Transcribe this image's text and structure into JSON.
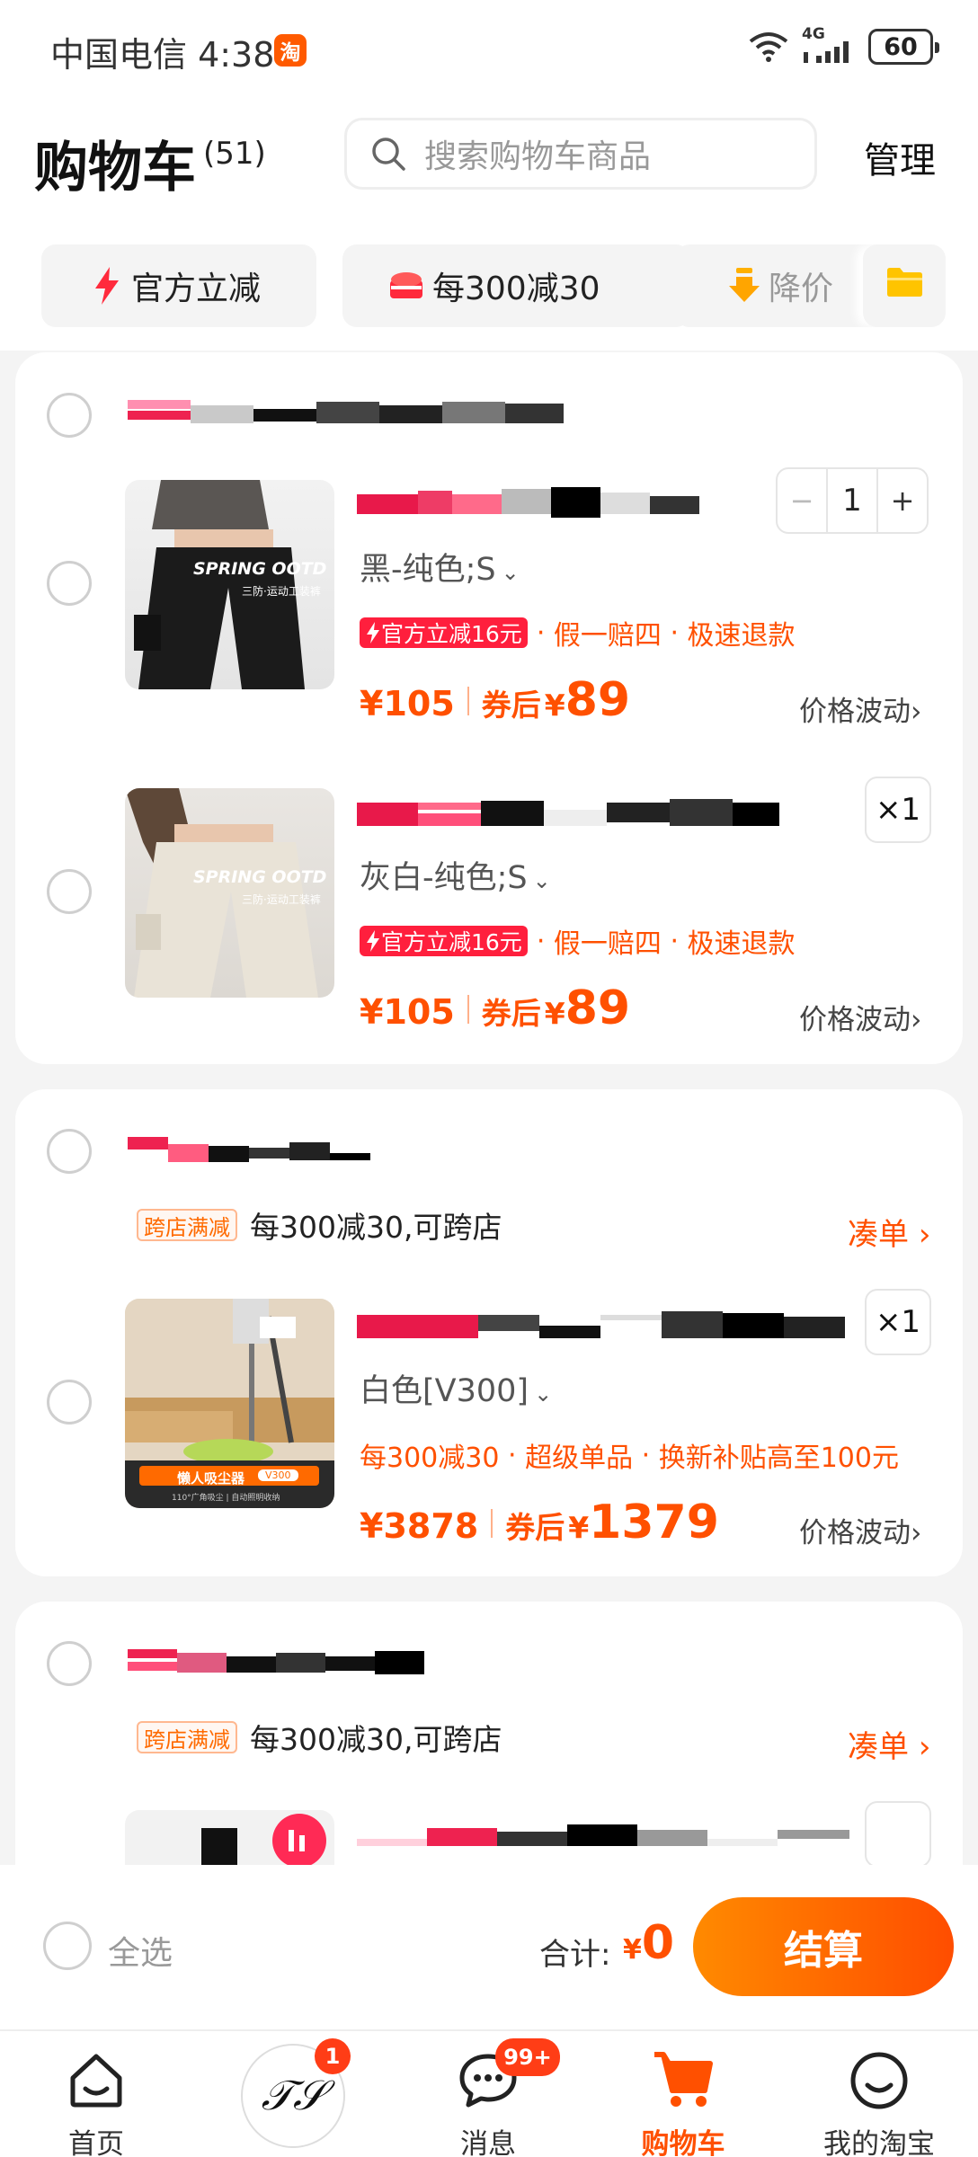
{
  "status_bar": {
    "carrier_time": "中国电信 4:38",
    "app_badge": "淘",
    "network": "4G",
    "battery": "60"
  },
  "header": {
    "title": "购物车",
    "count": "(51)",
    "search_placeholder": "搜索购物车商品",
    "manage": "管理"
  },
  "filter_chips": [
    {
      "label": "官方立减",
      "icon": "lightning-icon"
    },
    {
      "label": "每300减30",
      "icon": "gift-icon"
    },
    {
      "label": "降价",
      "icon": "down-arrow-icon"
    },
    {
      "label": "",
      "icon": "folder-icon"
    }
  ],
  "stores": [
    {
      "items": [
        {
          "variant": "黑-纯色;S",
          "promo_badge": "官方立减16元",
          "tags": [
            "假一赔四",
            "极速退款"
          ],
          "price": "¥105",
          "after_label": "券后",
          "after_currency": "¥",
          "after_price": "89",
          "fluctuation": "价格波动",
          "quantity": "1",
          "thumb_caption": "SPRING OOTD",
          "thumb_subcaption": "三防·运动工装裤"
        },
        {
          "variant": "灰白-纯色;S",
          "promo_badge": "官方立减16元",
          "tags": [
            "假一赔四",
            "极速退款"
          ],
          "price": "¥105",
          "after_label": "券后",
          "after_currency": "¥",
          "after_price": "89",
          "fluctuation": "价格波动",
          "quantity": "×1",
          "thumb_caption": "SPRING OOTD",
          "thumb_subcaption": "三防·运动工装裤"
        }
      ]
    },
    {
      "cross_badge": "跨店满减",
      "cross_text": "每300减30,可跨店",
      "coudan": "凑单",
      "items": [
        {
          "variant": "白色[V300]",
          "tags": [
            "每300减30",
            "超级单品",
            "换新补贴高至100元"
          ],
          "price": "¥3878",
          "after_label": "券后",
          "after_currency": "¥",
          "after_price": "1379",
          "fluctuation": "价格波动",
          "quantity": "×1",
          "thumb_caption": "懒人吸尘器",
          "thumb_tag": "V300",
          "thumb_subcaption": "110°广角吸尘 | 自动照明收纳"
        }
      ]
    },
    {
      "cross_badge": "跨店满减",
      "cross_text": "每300减30,可跨店",
      "coudan": "凑单"
    }
  ],
  "bottom_bar": {
    "select_all": "全选",
    "total_label": "合计:",
    "total_currency": "¥",
    "total_value": "0",
    "checkout": "结算"
  },
  "tab_bar": [
    {
      "label": "首页",
      "icon": "home-icon"
    },
    {
      "label": "",
      "icon": "store-logo-icon",
      "badge": "1"
    },
    {
      "label": "消息",
      "icon": "message-icon",
      "badge": "99+"
    },
    {
      "label": "购物车",
      "icon": "cart-icon",
      "active": true
    },
    {
      "label": "我的淘宝",
      "icon": "profile-icon"
    }
  ],
  "colors": {
    "accent": "#ff5000",
    "promo_red": "#ff1f3d",
    "checkout_start": "#ff8a00",
    "checkout_end": "#ff4d00"
  }
}
